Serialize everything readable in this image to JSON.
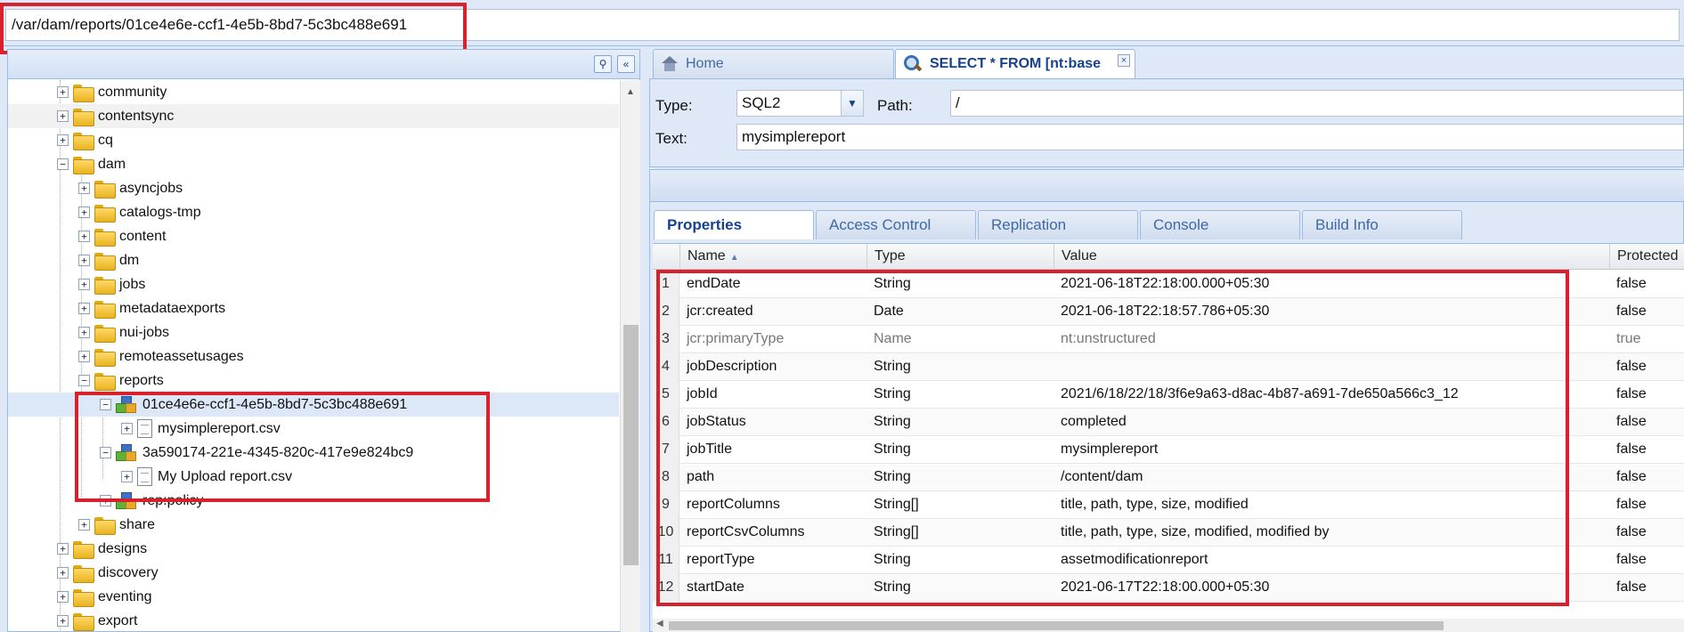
{
  "address": {
    "path": "/var/dam/reports/01ce4e6e-ccf1-4e5b-8bd7-5c3bc488e691"
  },
  "tree": {
    "header_buttons": [
      "⚲",
      "«"
    ],
    "rows": [
      {
        "label": "community",
        "expander": "+",
        "icon": "folder"
      },
      {
        "label": "contentsync",
        "expander": "+",
        "icon": "folder"
      },
      {
        "label": "cq",
        "expander": "+",
        "icon": "folder"
      },
      {
        "label": "dam",
        "expander": "−",
        "icon": "folder"
      },
      {
        "label": "asyncjobs",
        "expander": "+",
        "icon": "folder"
      },
      {
        "label": "catalogs-tmp",
        "expander": "+",
        "icon": "folder"
      },
      {
        "label": "content",
        "expander": "+",
        "icon": "folder"
      },
      {
        "label": "dm",
        "expander": "+",
        "icon": "folder"
      },
      {
        "label": "jobs",
        "expander": "+",
        "icon": "folder"
      },
      {
        "label": "metadataexports",
        "expander": "+",
        "icon": "folder"
      },
      {
        "label": "nui-jobs",
        "expander": "+",
        "icon": "folder"
      },
      {
        "label": "remoteassetusages",
        "expander": "+",
        "icon": "folder"
      },
      {
        "label": "reports",
        "expander": "−",
        "icon": "folder"
      },
      {
        "label": "01ce4e6e-ccf1-4e5b-8bd7-5c3bc488e691",
        "expander": "−",
        "icon": "node"
      },
      {
        "label": "mysimplereport.csv",
        "expander": "+",
        "icon": "file"
      },
      {
        "label": "3a590174-221e-4345-820c-417e9e824bc9",
        "expander": "−",
        "icon": "node"
      },
      {
        "label": "My Upload report.csv",
        "expander": "+",
        "icon": "file"
      },
      {
        "label": "rep:policy",
        "expander": "+",
        "icon": "node"
      },
      {
        "label": "share",
        "expander": "+",
        "icon": "folder"
      },
      {
        "label": "designs",
        "expander": "+",
        "icon": "folder"
      },
      {
        "label": "discovery",
        "expander": "+",
        "icon": "folder"
      },
      {
        "label": "eventing",
        "expander": "+",
        "icon": "folder"
      },
      {
        "label": "export",
        "expander": "+",
        "icon": "folder"
      }
    ]
  },
  "tabs": {
    "home": "Home",
    "query": "SELECT * FROM [nt:base",
    "close": "×"
  },
  "query": {
    "type_label": "Type:",
    "type_value": "SQL2",
    "path_label": "Path:",
    "path_value": "/",
    "text_label": "Text:",
    "text_value": "mysimplereport"
  },
  "property_tabs": [
    "Properties",
    "Access Control",
    "Replication",
    "Console",
    "Build Info"
  ],
  "grid": {
    "columns": [
      "Name",
      "Type",
      "Value",
      "Protected"
    ],
    "rows": [
      {
        "n": "1",
        "name": "endDate",
        "type": "String",
        "value": "2021-06-18T22:18:00.000+05:30",
        "protected": "false"
      },
      {
        "n": "2",
        "name": "jcr:created",
        "type": "Date",
        "value": "2021-06-18T22:18:57.786+05:30",
        "protected": "false"
      },
      {
        "n": "3",
        "name": "jcr:primaryType",
        "type": "Name",
        "value": "nt:unstructured",
        "protected": "true"
      },
      {
        "n": "4",
        "name": "jobDescription",
        "type": "String",
        "value": "",
        "protected": "false"
      },
      {
        "n": "5",
        "name": "jobId",
        "type": "String",
        "value": "2021/6/18/22/18/3f6e9a63-d8ac-4b87-a691-7de650a566c3_12",
        "protected": "false"
      },
      {
        "n": "6",
        "name": "jobStatus",
        "type": "String",
        "value": "completed",
        "protected": "false"
      },
      {
        "n": "7",
        "name": "jobTitle",
        "type": "String",
        "value": "mysimplereport",
        "protected": "false"
      },
      {
        "n": "8",
        "name": "path",
        "type": "String",
        "value": "/content/dam",
        "protected": "false"
      },
      {
        "n": "9",
        "name": "reportColumns",
        "type": "String[]",
        "value": "title, path, type, size, modified",
        "protected": "false"
      },
      {
        "n": "10",
        "name": "reportCsvColumns",
        "type": "String[]",
        "value": "title, path, type, size, modified, modified by",
        "protected": "false"
      },
      {
        "n": "11",
        "name": "reportType",
        "type": "String",
        "value": "assetmodificationreport",
        "protected": "false"
      },
      {
        "n": "12",
        "name": "startDate",
        "type": "String",
        "value": "2021-06-17T22:18:00.000+05:30",
        "protected": "false"
      }
    ]
  },
  "colors": {
    "highlight": "#d9212d",
    "accent": "#15428b"
  }
}
